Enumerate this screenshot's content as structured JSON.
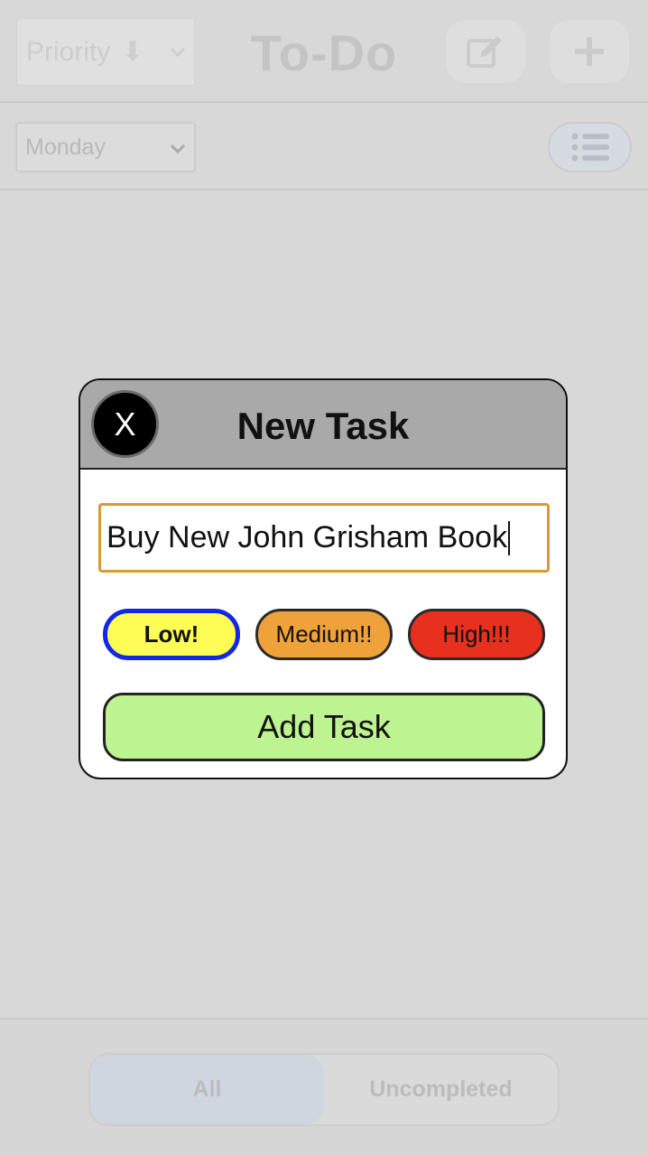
{
  "header": {
    "sort_label": "Priority",
    "sort_arrow": "⬇",
    "title": "To-Do",
    "edit_icon": "edit-icon",
    "add_icon": "plus-icon"
  },
  "subbar": {
    "day_value": "Monday",
    "list_icon": "list-icon"
  },
  "footer": {
    "segments": [
      "All",
      "Uncompleted"
    ],
    "active_segment": "All"
  },
  "modal": {
    "title": "New Task",
    "close_label": "X",
    "input_value": "Buy New John Grisham Book",
    "priorities": [
      "Low!",
      "Medium!!",
      "High!!!"
    ],
    "selected_priority": "Low!",
    "add_button_label": "Add Task"
  },
  "colors": {
    "low": "#fdfd55",
    "low_selected_border": "#1228e6",
    "medium": "#f0a23a",
    "high": "#e8301e",
    "add_button": "#bdf391",
    "input_border": "#d89a3a",
    "modal_header": "#a9a9a9"
  }
}
